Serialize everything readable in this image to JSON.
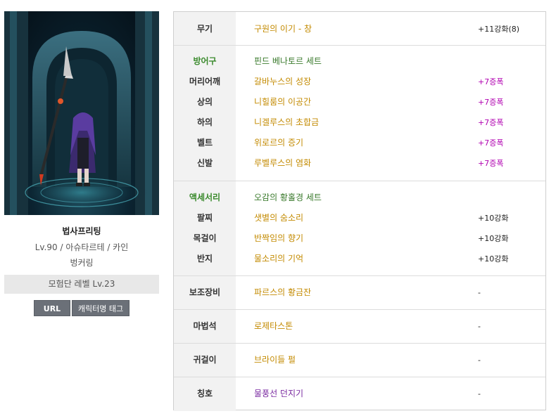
{
  "profile": {
    "name": "법사프리팅",
    "info": "Lv.90 / 아슈타르테 / 카인",
    "guild": "벙커링",
    "adventure_level": "모험단 레벨 Lv.23",
    "url_button": "URL",
    "tag_button": "캐릭터명 태그"
  },
  "equipment": {
    "weapon": {
      "slot": "무기",
      "item": "구원의 이기 - 창",
      "enhance": "+11강화(8)"
    },
    "armor": {
      "category": "방어구",
      "set": "핀드 베나토르 세트",
      "items": [
        {
          "slot": "머리어깨",
          "item": "갈바누스의 성장",
          "enhance": "+7증폭"
        },
        {
          "slot": "상의",
          "item": "니힐룸의 이공간",
          "enhance": "+7증폭"
        },
        {
          "slot": "하의",
          "item": "니겔루스의 초합금",
          "enhance": "+7증폭"
        },
        {
          "slot": "벨트",
          "item": "위로르의 증기",
          "enhance": "+7증폭"
        },
        {
          "slot": "신발",
          "item": "루벨루스의 염화",
          "enhance": "+7증폭"
        }
      ]
    },
    "accessory": {
      "category": "액세서리",
      "set": "오감의 황홀경 세트",
      "items": [
        {
          "slot": "팔찌",
          "item": "샛별의 숨소리",
          "enhance": "+10강화"
        },
        {
          "slot": "목걸이",
          "item": "반짝임의 향기",
          "enhance": "+10강화"
        },
        {
          "slot": "반지",
          "item": "물소리의 기억",
          "enhance": "+10강화"
        }
      ]
    },
    "sub_weapon": {
      "slot": "보조장비",
      "item": "파르스의 황금잔",
      "enhance": "-"
    },
    "magic_stone": {
      "slot": "마법석",
      "item": "로제타스톤",
      "enhance": "-"
    },
    "earring": {
      "slot": "귀걸이",
      "item": "브라이들 펄",
      "enhance": "-"
    },
    "title": {
      "slot": "칭호",
      "item": "물풍선 던지기",
      "enhance": "-"
    }
  },
  "colors": {
    "legendary_item": "#c38a00",
    "set_name": "#3a7a2c",
    "amplify": "#b000b0",
    "title_item": "#7a2aa0",
    "button_bg": "#6b7078"
  }
}
